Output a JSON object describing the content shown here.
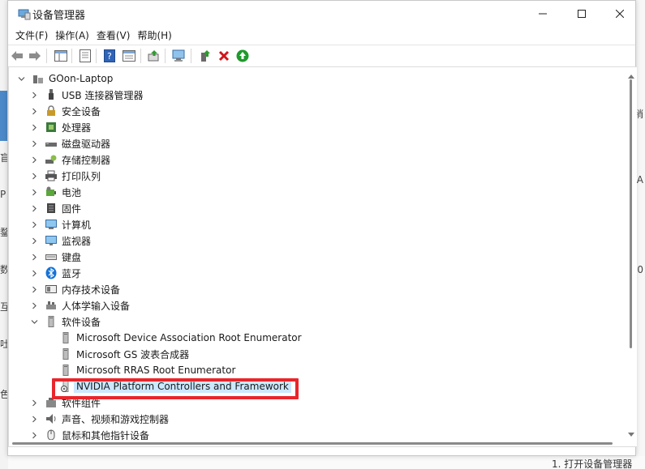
{
  "window": {
    "title": "设备管理器"
  },
  "menu": [
    {
      "label": "文件(F)"
    },
    {
      "label": "操作(A)"
    },
    {
      "label": "查看(V)"
    },
    {
      "label": "帮助(H)"
    }
  ],
  "tree": {
    "root": "GOon-Laptop",
    "items": [
      {
        "label": "USB 连接器管理器",
        "icon": "usb-connector-icon"
      },
      {
        "label": "安全设备",
        "icon": "security-device-icon"
      },
      {
        "label": "处理器",
        "icon": "processor-icon"
      },
      {
        "label": "磁盘驱动器",
        "icon": "disk-drive-icon"
      },
      {
        "label": "存储控制器",
        "icon": "storage-controller-icon"
      },
      {
        "label": "打印队列",
        "icon": "printer-icon"
      },
      {
        "label": "电池",
        "icon": "battery-icon"
      },
      {
        "label": "固件",
        "icon": "firmware-icon"
      },
      {
        "label": "计算机",
        "icon": "computer-icon"
      },
      {
        "label": "监视器",
        "icon": "monitor-icon"
      },
      {
        "label": "键盘",
        "icon": "keyboard-icon"
      },
      {
        "label": "蓝牙",
        "icon": "bluetooth-icon"
      },
      {
        "label": "内存技术设备",
        "icon": "memory-device-icon"
      },
      {
        "label": "人体学输入设备",
        "icon": "hid-icon"
      }
    ],
    "software_devices": {
      "label": "软件设备",
      "children": [
        {
          "label": "Microsoft Device Association Root Enumerator"
        },
        {
          "label": "Microsoft GS 波表合成器"
        },
        {
          "label": "Microsoft RRAS Root Enumerator"
        },
        {
          "label": "NVIDIA Platform Controllers and Framework"
        }
      ]
    },
    "after_items": [
      {
        "label": "软件组件"
      },
      {
        "label": "声音、视频和游戏控制器"
      },
      {
        "label": "鼠标和其他指针设备"
      }
    ]
  },
  "background": {
    "left_fragments": [
      "盲",
      "P",
      "鍪",
      "数",
      "互",
      "吐",
      "色"
    ],
    "right_fragments": [
      "稍",
      "A",
      "0"
    ],
    "bottom_fragment": "1. 打开设备管理器"
  },
  "colors": {
    "highlight_box": "#e8262c",
    "selection": "#cce8ff"
  }
}
